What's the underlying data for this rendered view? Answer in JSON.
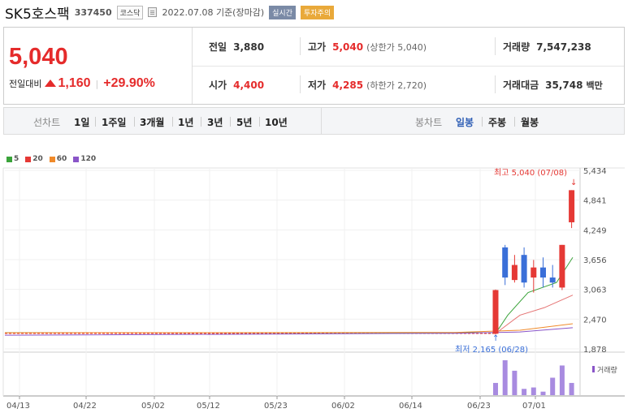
{
  "header": {
    "name": "SK5호스팩",
    "code": "337450",
    "market": "코스닥",
    "date_text": "2022.07.08 기준(장마감)",
    "realtime": "실시간",
    "warning": "투자주의"
  },
  "quote": {
    "price": "5,040",
    "change_label": "전일대비",
    "change": "1,160",
    "change_pct": "+29.90%",
    "prev_label": "전일",
    "prev": "3,880",
    "open_label": "시가",
    "open": "4,400",
    "high_label": "고가",
    "high": "5,040",
    "high_sub": "(상한가 5,040)",
    "low_label": "저가",
    "low": "4,285",
    "low_sub": "(하한가 2,720)",
    "volume_label": "거래량",
    "volume": "7,547,238",
    "amount_label": "거래대금",
    "amount": "35,748",
    "amount_unit": "백만"
  },
  "period_bar": {
    "label": "선차트",
    "items": [
      "1일",
      "1주일",
      "3개월",
      "1년",
      "3년",
      "5년",
      "10년"
    ],
    "candle_label": "봉차트",
    "candle_items": [
      "일봉",
      "주봉",
      "월봉"
    ],
    "active_candle": "일봉"
  },
  "legend": [
    {
      "name": "5",
      "color": "#3aa33a"
    },
    {
      "name": "20",
      "color": "#e53935"
    },
    {
      "name": "60",
      "color": "#f08a2a"
    },
    {
      "name": "120",
      "color": "#8a55c8"
    }
  ],
  "chart_data": {
    "type": "candlestick",
    "x_ticks": [
      "04/13",
      "04/22",
      "05/02",
      "05/12",
      "05/23",
      "06/02",
      "06/14",
      "06/23",
      "07/01"
    ],
    "y_ticks": [
      "5,434",
      "4,841",
      "4,249",
      "3,656",
      "3,063",
      "2,470",
      "1,878"
    ],
    "ylim": [
      1878,
      5434
    ],
    "max_annotation": "최고 5,040 (07/08)",
    "min_annotation": "최저 2,165 (06/28)",
    "volume_label": "거래량",
    "candles": [
      {
        "open": 2180,
        "close": 3050,
        "high": 3060,
        "low": 2165,
        "color": "red"
      },
      {
        "open": 3900,
        "close": 3300,
        "high": 3950,
        "low": 3150,
        "color": "blue"
      },
      {
        "open": 3250,
        "close": 3550,
        "high": 3750,
        "low": 3200,
        "color": "red"
      },
      {
        "open": 3750,
        "close": 3200,
        "high": 3900,
        "low": 3100,
        "color": "blue"
      },
      {
        "open": 3300,
        "close": 3500,
        "high": 3650,
        "low": 3000,
        "color": "red"
      },
      {
        "open": 3500,
        "close": 3300,
        "high": 3700,
        "low": 3100,
        "color": "blue"
      },
      {
        "open": 3300,
        "close": 3200,
        "high": 3550,
        "low": 3100,
        "color": "blue"
      },
      {
        "open": 3100,
        "close": 3950,
        "high": 3950,
        "low": 3050,
        "color": "red"
      },
      {
        "open": 4400,
        "close": 5040,
        "high": 5040,
        "low": 4285,
        "color": "red"
      }
    ],
    "volumes": [
      0.35,
      1.0,
      0.7,
      0.18,
      0.22,
      0.1,
      0.5,
      0.85,
      0.35
    ]
  }
}
